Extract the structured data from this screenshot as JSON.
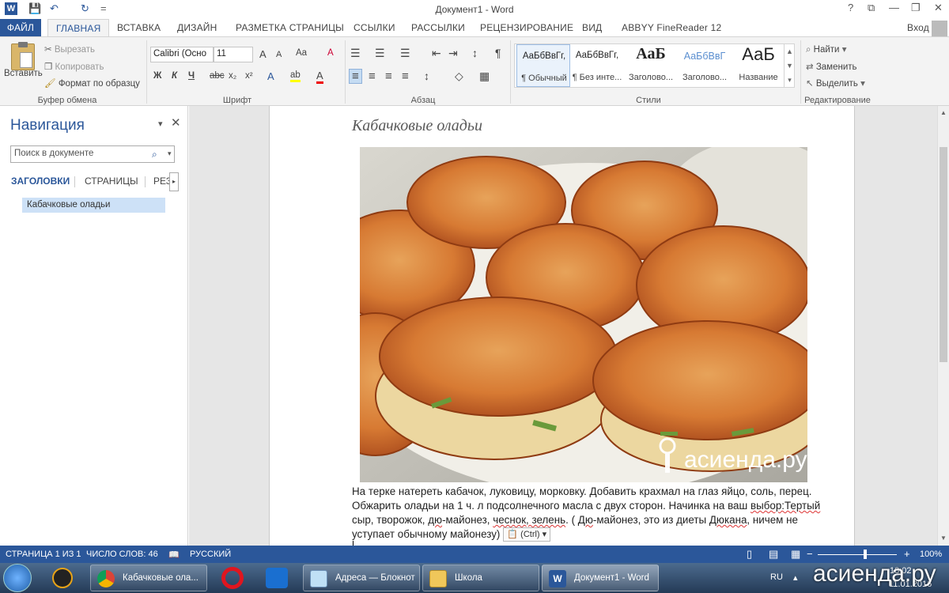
{
  "titlebar": {
    "title": "Документ1 - Word",
    "qa_word": "W",
    "qa_save": "💾",
    "qa_undo": "↶",
    "qa_redo": "↻",
    "qa_customize": "=",
    "help": "?",
    "win_restore_ribbon": "⧉",
    "win_min": "—",
    "win_max": "❐",
    "win_close": "✕"
  },
  "tabs": {
    "file": "ФАЙЛ",
    "home": "ГЛАВНАЯ",
    "insert": "ВСТАВКА",
    "design": "ДИЗАЙН",
    "layout": "РАЗМЕТКА СТРАНИЦЫ",
    "references": "ССЫЛКИ",
    "mailings": "РАССЫЛКИ",
    "review": "РЕЦЕНЗИРОВАНИЕ",
    "view": "ВИД",
    "abbyy": "ABBYY FineReader 12",
    "signin": "Вход"
  },
  "clipboard": {
    "paste": "Вставить",
    "cut": "Вырезать",
    "copy": "Копировать",
    "format_painter": "Формат по образцу",
    "label": "Буфер обмена"
  },
  "font": {
    "name": "Calibri (Осно",
    "size": "11",
    "grow": "A",
    "shrink": "A",
    "case": "Aa",
    "clear": "A",
    "bold": "Ж",
    "italic": "К",
    "underline": "Ч",
    "strike": "abc",
    "sub": "x₂",
    "sup": "x²",
    "effects": "A",
    "highlight": "ab",
    "color": "A",
    "label": "Шрифт"
  },
  "paragraph": {
    "bullets": "☰",
    "numbering": "☰",
    "multilevel": "☰",
    "dec_indent": "⇤",
    "inc_indent": "⇥",
    "sort": "↕",
    "pilcrow": "¶",
    "align_left": "≡",
    "center": "≡",
    "align_right": "≡",
    "justify": "≡",
    "spacing": "↕",
    "shading": "◇",
    "borders": "▦",
    "label": "Абзац"
  },
  "styles": {
    "items": [
      {
        "preview": "АаБбВвГг,",
        "name": "¶ Обычный"
      },
      {
        "preview": "АаБбВвГг,",
        "name": "¶ Без инте..."
      },
      {
        "preview": "АаБ",
        "name": "Заголово..."
      },
      {
        "preview": "АаБбВвГ",
        "name": "Заголово..."
      },
      {
        "preview": "АаБ",
        "name": "Название"
      }
    ],
    "label": "Стили"
  },
  "editing": {
    "find": "Найти",
    "replace": "Заменить",
    "select": "Выделить",
    "label": "Редактирование"
  },
  "nav": {
    "title": "Навигация",
    "search_placeholder": "Поиск в документе",
    "tab_headings": "ЗАГОЛОВКИ",
    "tab_pages": "СТРАНИЦЫ",
    "tab_results": "РЕЗ",
    "heading_item": "Кабачковые оладьи"
  },
  "doc": {
    "title": "Кабачковые оладьи",
    "watermark": "асиенда.ру",
    "text_a": "На терке натереть кабачок, луковицу, морковку. Добавить крахмал на глаз яйцо, соль, перец. Обжарить оладьи на 1 ч. л подсолнечного масла с двух сторон. Начинка на ваш ",
    "text_sq1": "выбор:Тертый",
    "text_b": " сыр, творожок, ",
    "text_sq2": "дю",
    "text_c": "-майонез, ",
    "text_sq3": "чеснок, зелень",
    "text_d": ". ( ",
    "text_sq4": "Дю",
    "text_e": "-майонез, это из диеты ",
    "text_sq5": "Дюкана",
    "text_f": ", ничем не уступает обычному майонезу)",
    "paste_options": "(Ctrl)"
  },
  "status": {
    "page": "СТРАНИЦА 1 ИЗ 1",
    "words": "ЧИСЛО СЛОВ: 46",
    "lang": "РУССКИЙ",
    "zoom": "100%",
    "zoom_minus": "−",
    "zoom_plus": "+"
  },
  "taskbar": {
    "items": [
      "Кабачковые ола...",
      "Адреса — Блокнот",
      "Школа",
      "Документ1 - Word"
    ],
    "lang": "RU",
    "time": "18:02",
    "date": "11.01.2016",
    "watermark": "асиенда.ру"
  },
  "colors": {
    "accent": "#2b579a",
    "ribbon_bg": "#f3f3f3",
    "doc_bg": "#e6e6e6"
  }
}
